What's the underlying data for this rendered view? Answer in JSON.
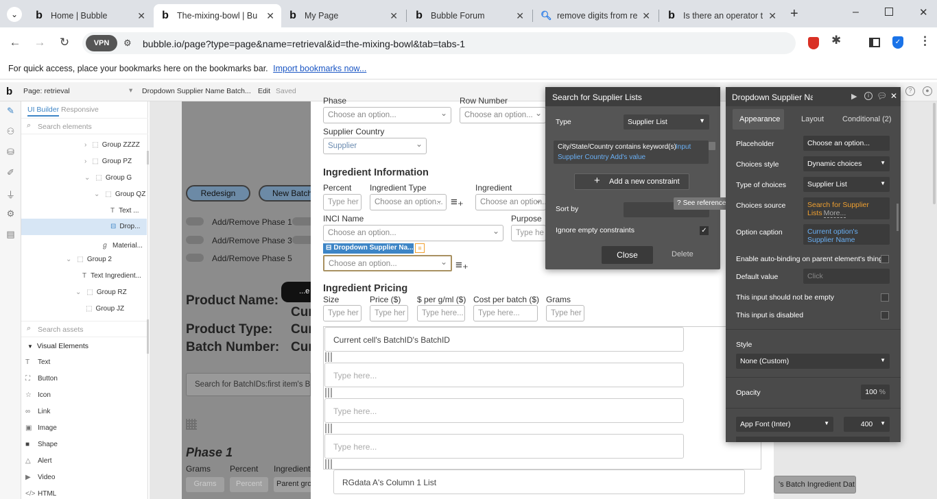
{
  "browser": {
    "tabs": [
      {
        "title": "Home | Bubble"
      },
      {
        "title": "The-mixing-bowl | Bu"
      },
      {
        "title": "My Page"
      },
      {
        "title": "Bubble Forum"
      },
      {
        "title": "remove digits from re"
      },
      {
        "title": "Is there an operator t"
      }
    ],
    "vpn_label": "VPN",
    "url": "bubble.io/page?type=page&name=retrieval&id=the-mixing-bowl&tab=tabs-1",
    "bookmarks_text": "For quick access, place your bookmarks here on the bookmarks bar.",
    "bookmarks_link": "Import bookmarks now..."
  },
  "editor_bar": {
    "logo": "b",
    "page_label": "Page: retrieval",
    "element_label": "Dropdown Supplier Name Batch...",
    "edit": "Edit",
    "saved": "Saved"
  },
  "tree": {
    "tab_ui_builder": "UI Builder",
    "tab_responsive": "Responsive",
    "search_placeholder": "Search elements",
    "items": [
      "Group ZZZZ",
      "Group PZ",
      "Group G",
      "Group QZ",
      "Text ...",
      "Drop...",
      "Material...",
      "Group 2",
      "Text Ingredient...",
      "Group RZ",
      "Group JZ"
    ],
    "assets_placeholder": "Search assets",
    "visual_header": "Visual Elements",
    "visual_items": [
      "Text",
      "Button",
      "Icon",
      "Link",
      "Image",
      "Shape",
      "Alert",
      "Video",
      "HTML"
    ]
  },
  "canvas": {
    "phase_label": "Phase",
    "row_number_label": "Row Number",
    "choose_option": "Choose an option...",
    "supplier_country_label": "Supplier Country",
    "supplier_value": "Supplier",
    "ingredient_info_header": "Ingredient Information",
    "percent_label": "Percent",
    "ingredient_type_label": "Ingredient Type",
    "ingredient_label": "Ingredient",
    "type_here_short": "Type her",
    "inci_label": "INCI Name",
    "purpose_label": "Purpose",
    "purpose_placeholder": "Type he",
    "selected_tag": "Dropdown Supplier Na...",
    "pricing_header": "Ingredient Pricing",
    "pricing_labels": [
      "Size",
      "Price ($)",
      "$ per g/ml ($)",
      "Cost per batch ($)",
      "Grams"
    ],
    "pricing_placeholders": [
      "Type her",
      "Type her",
      "Type here...",
      "Type here...",
      "Type her"
    ],
    "rg_first": "Current cell's BatchID's BatchID",
    "type_here": "Type here...",
    "rg_bottom": "RGdata A's Column 1 List",
    "redesign": "Redesign",
    "new_batch": "New Batch",
    "phase_toggles": [
      "Add/Remove Phase 1",
      "Add/Remove Phase 3",
      "Add/Remove Phase 5"
    ],
    "black_btn": "...e",
    "product_name": "Product Name:",
    "product_type": "Product Type:",
    "batch_number": "Batch Number:",
    "cur": "Cur",
    "search_batch": "Search for BatchIDs:first item's B",
    "phase1": "Phase 1",
    "phase1_cols": [
      "Grams",
      "Percent",
      "Ingredient"
    ],
    "phase1_grams": "Grams",
    "phase1_percent": "Percent",
    "parent_group": "Parent gro",
    "right_gray": "'s Batch Ingredient Dat"
  },
  "search_popup": {
    "title": "Search for Supplier Lists",
    "type_label": "Type",
    "type_value": "Supplier List",
    "constraint_main": "City/State/Country contains keyword(s)",
    "constraint_input": "Input",
    "constraint_sub": "Supplier Country Add's value",
    "add_constraint": "Add a new constraint",
    "sort_by": "Sort by",
    "see_reference": "See reference →",
    "ignore_empty": "Ignore empty constraints",
    "close": "Close",
    "delete": "Delete"
  },
  "prop_panel": {
    "title": "Dropdown Supplier Nan",
    "tabs": [
      "Appearance",
      "Layout",
      "Conditional (2)"
    ],
    "placeholder_label": "Placeholder",
    "placeholder_value": "Choose an option...",
    "choices_style_label": "Choices style",
    "choices_style_value": "Dynamic choices",
    "type_choices_label": "Type of choices",
    "type_choices_value": "Supplier List",
    "choices_source_label": "Choices source",
    "choices_source_value": "Search for Supplier Lists",
    "more": "More...",
    "option_caption_label": "Option caption",
    "option_caption_value": "Current option's Supplier Name",
    "auto_binding": "Enable auto-binding on parent element's thing",
    "default_label": "Default value",
    "default_value": "Click",
    "not_empty": "This input should not be empty",
    "disabled": "This input is disabled",
    "style_label": "Style",
    "style_value": "None (Custom)",
    "opacity_label": "Opacity",
    "opacity_value": "100",
    "opacity_unit": "%",
    "font_value": "App Font (Inter)",
    "weight_value": "400"
  },
  "colors": {
    "accent_blue": "#1a73e8",
    "bubble_blue": "#3d85c6",
    "orange": "#f0a030"
  }
}
